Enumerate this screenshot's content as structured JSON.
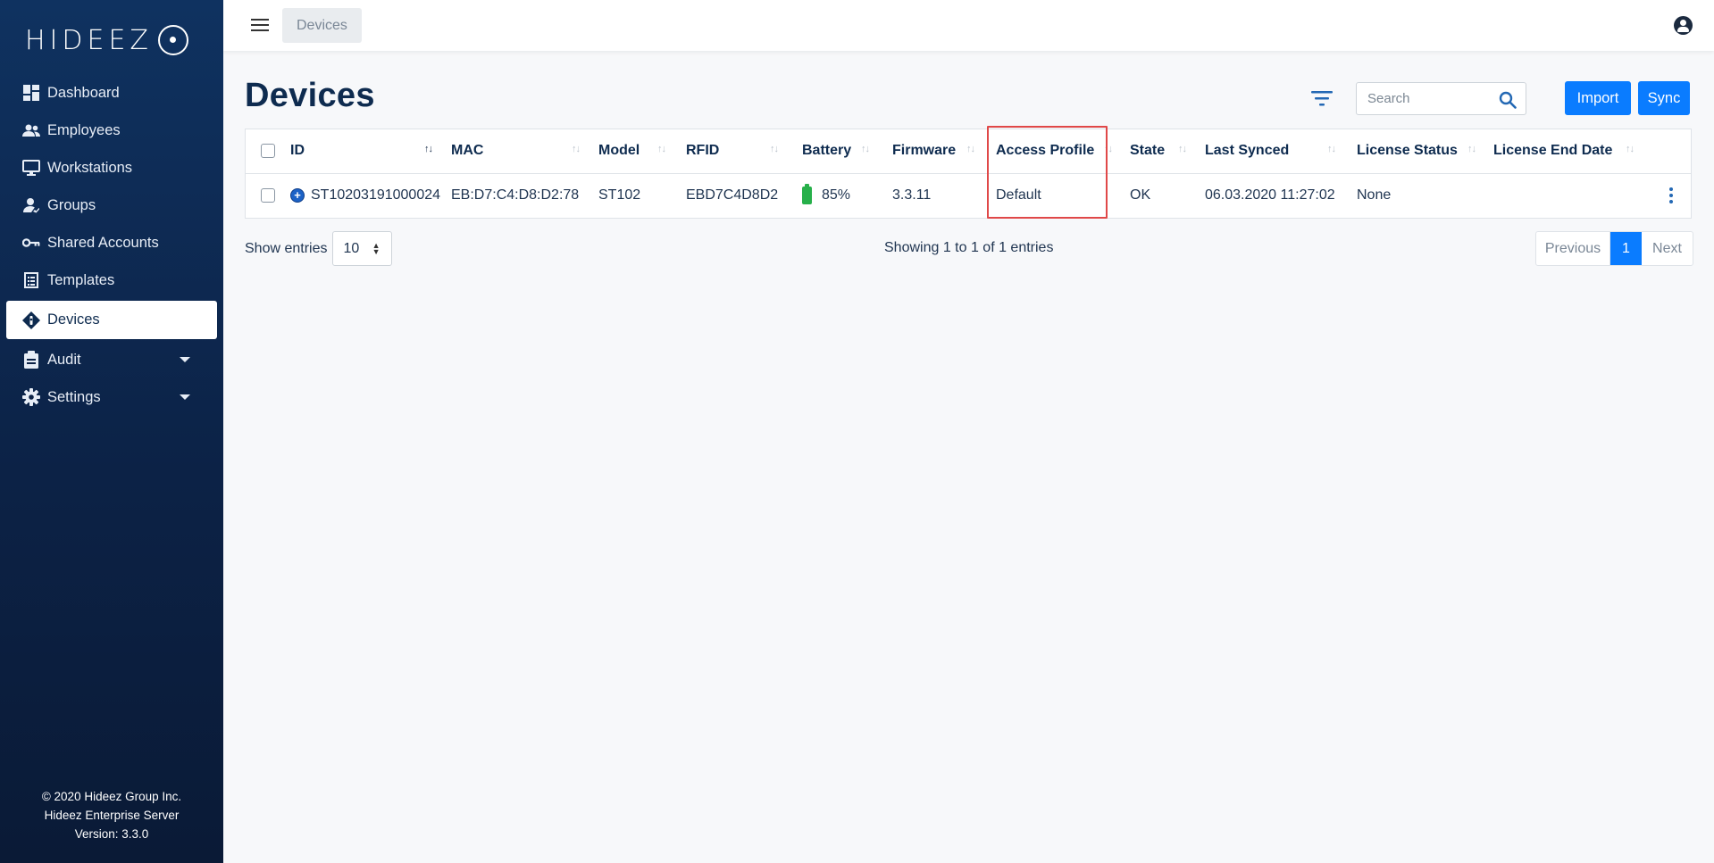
{
  "app": {
    "logo_text": "HIDEEZ"
  },
  "sidebar": {
    "items": [
      {
        "label": "Dashboard",
        "icon": "dashboard-icon"
      },
      {
        "label": "Employees",
        "icon": "users-icon"
      },
      {
        "label": "Workstations",
        "icon": "monitor-icon"
      },
      {
        "label": "Groups",
        "icon": "group-icon"
      },
      {
        "label": "Shared Accounts",
        "icon": "key-icon"
      },
      {
        "label": "Templates",
        "icon": "template-icon"
      },
      {
        "label": "Devices",
        "icon": "device-icon",
        "active": true
      },
      {
        "label": "Audit",
        "icon": "clipboard-icon",
        "caret": true
      },
      {
        "label": "Settings",
        "icon": "gear-icon",
        "caret": true
      }
    ],
    "footer": {
      "copyright": "© 2020 Hideez Group Inc.",
      "product": "Hideez Enterprise Server",
      "version": "Version: 3.3.0"
    }
  },
  "topbar": {
    "breadcrumb": "Devices"
  },
  "main": {
    "title": "Devices",
    "search_placeholder": "Search",
    "import_label": "Import",
    "sync_label": "Sync",
    "table": {
      "columns": [
        "ID",
        "MAC",
        "Model",
        "RFID",
        "Battery",
        "Firmware",
        "Access Profile",
        "State",
        "Last Synced",
        "License Status",
        "License End Date"
      ],
      "rows": [
        {
          "id": "ST10203191000024",
          "mac": "EB:D7:C4:D8:D2:78",
          "model": "ST102",
          "rfid": "EBD7C4D8D2",
          "battery": "85%",
          "firmware": "3.3.11",
          "access_profile": "Default",
          "state": "OK",
          "last_synced": "06.03.2020 11:27:02",
          "license_status": "None",
          "license_end_date": ""
        }
      ]
    },
    "show_entries_label": "Show entries",
    "page_size": "10",
    "showing_text": "Showing 1 to 1 of 1 entries",
    "pagination": {
      "previous": "Previous",
      "current": "1",
      "next": "Next"
    }
  },
  "colors": {
    "primary": "#0a7cff",
    "sidebar": "#0c2246",
    "highlight": "#e04848",
    "battery": "#27b04a"
  }
}
